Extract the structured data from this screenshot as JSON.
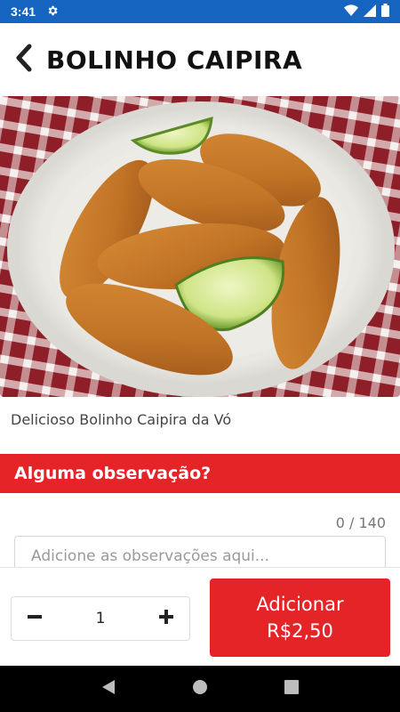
{
  "status_bar": {
    "time": "3:41"
  },
  "header": {
    "title": "BOLINHO CAIPIRA"
  },
  "product": {
    "description": "Delicioso Bolinho Caipira da Vó"
  },
  "observation": {
    "section_title": "Alguma observação?",
    "counter": "0 / 140",
    "placeholder": "Adicione as observações aqui..."
  },
  "order": {
    "quantity": "1",
    "add_label": "Adicionar",
    "price": "R$2,50"
  },
  "colors": {
    "accent": "#e52428",
    "status_bar": "#1565c0"
  }
}
